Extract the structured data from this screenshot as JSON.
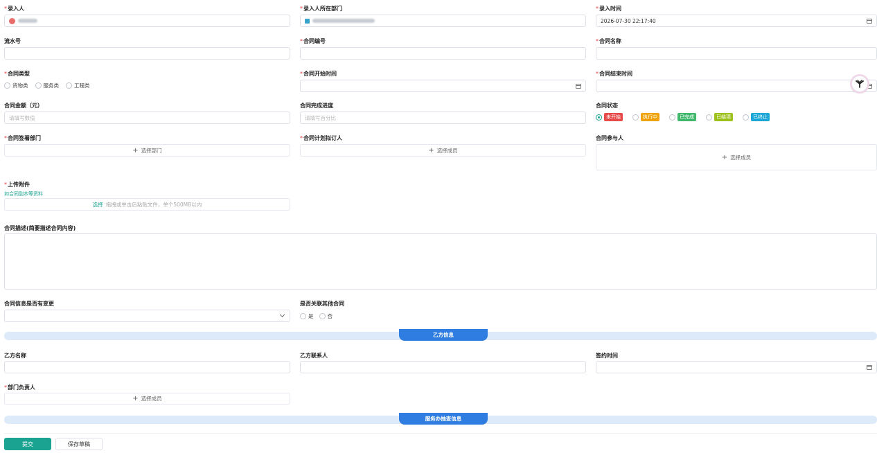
{
  "row1": {
    "entrant_label": "录入人",
    "dept_label": "录入人所在部门",
    "time_label": "录入时间",
    "time_value": "2026-07-30 22:17:40"
  },
  "row2": {
    "serial_label": "流水号",
    "contract_no_label": "合同编号",
    "contract_name_label": "合同名称"
  },
  "row3": {
    "type_label": "合同类型",
    "type_options": [
      "货物类",
      "服务类",
      "工程类"
    ],
    "start_label": "合同开始时间",
    "end_label": "合同结束时间"
  },
  "row4": {
    "amount_label": "合同金额（元）",
    "amount_placeholder": "请填写数值",
    "progress_label": "合同完成进度",
    "progress_placeholder": "请填写百分比",
    "status_label": "合同状态",
    "status_options": [
      {
        "label": "未开始",
        "color": "#e84a4a",
        "selected": true
      },
      {
        "label": "执行中",
        "color": "#f0a20b",
        "selected": false
      },
      {
        "label": "已完成",
        "color": "#3fb86c",
        "selected": false
      },
      {
        "label": "已结项",
        "color": "#9cc11a",
        "selected": false
      },
      {
        "label": "已终止",
        "color": "#1aa6d6",
        "selected": false
      }
    ]
  },
  "row5": {
    "sign_dept_label": "合同签署部门",
    "sign_dept_picker": "选择部门",
    "drafter_label": "合同计划拟订人",
    "drafter_picker": "选择成员",
    "participants_label": "合同参与人",
    "participants_picker": "选择成员"
  },
  "attachment": {
    "label": "上传附件",
    "hint": "如合同副本等资料",
    "select_link": "选择",
    "drop_text": "拖拽或单击后粘贴文件，单个500MB以内"
  },
  "description": {
    "label": "合同描述(简要描述合同内容)"
  },
  "row7": {
    "changed_label": "合同信息是否有变更",
    "linked_label": "是否关联其他合同",
    "linked_options": [
      "是",
      "否"
    ]
  },
  "party_b_section": {
    "title": "乙方信息",
    "name_label": "乙方名称",
    "contact_label": "乙方联系人",
    "sign_time_label": "签约时间",
    "dept_head_label": "部门负责人",
    "dept_head_picker": "选择成员"
  },
  "service_section": {
    "title": "服务办抽查信息"
  },
  "footer": {
    "submit_label": "提交",
    "draft_label": "保存草稿"
  },
  "colors": {
    "accent": "#1aa391",
    "required": "#e03b3b",
    "section_bar": "#ddeaf9",
    "section_tab": "#2f7de0"
  }
}
